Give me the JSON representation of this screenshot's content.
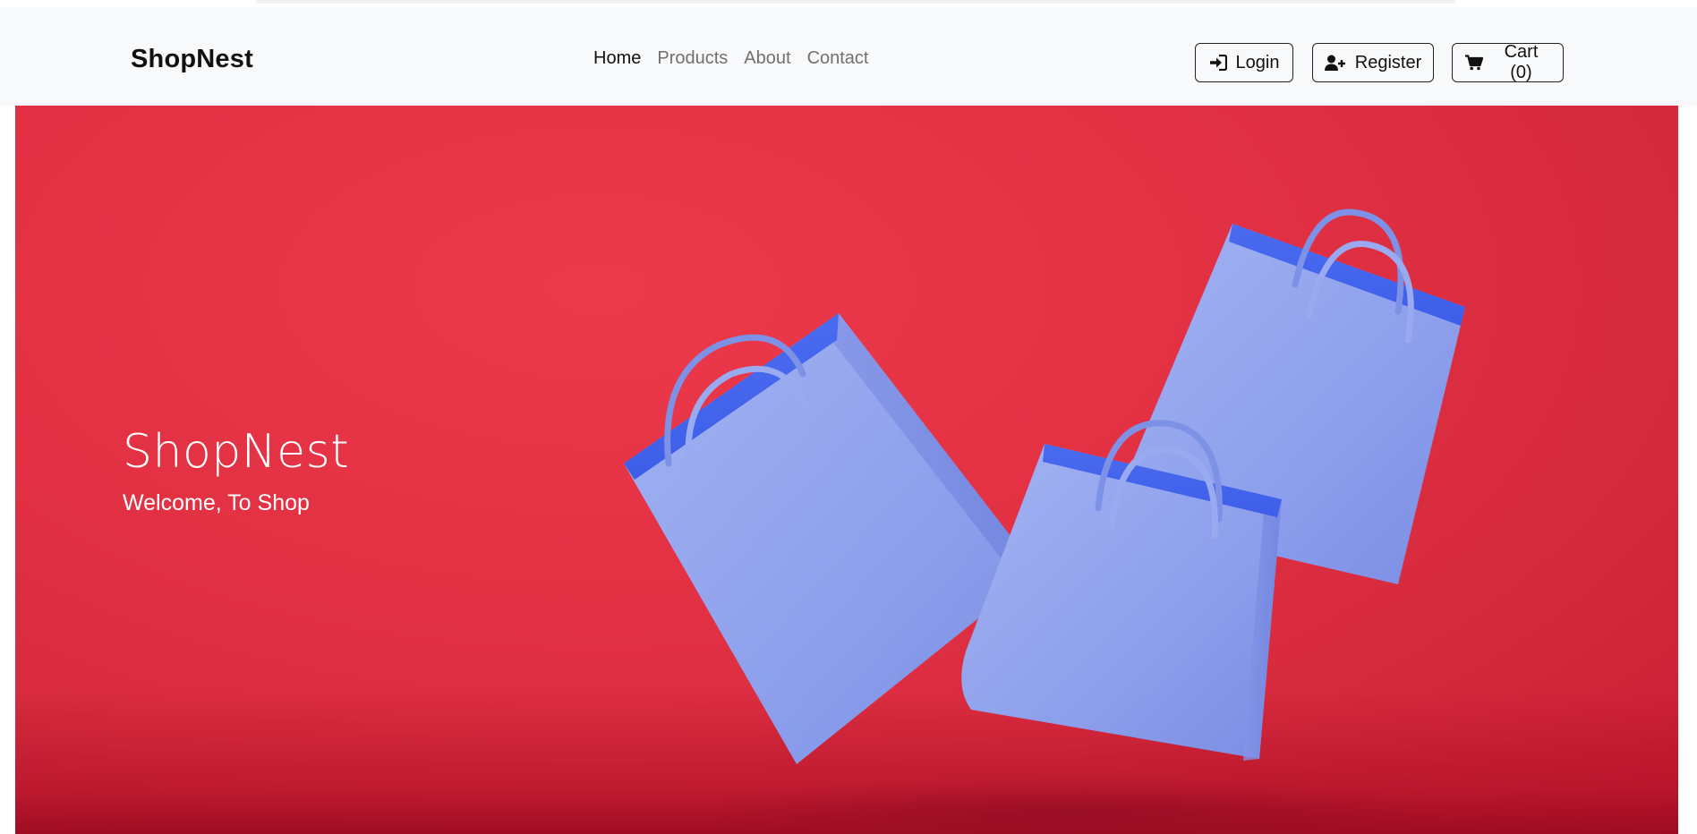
{
  "navbar": {
    "brand": "ShopNest",
    "links": [
      "Home",
      "Products",
      "About",
      "Contact"
    ],
    "active_link": "Home",
    "buttons": {
      "login": "Login",
      "register": "Register",
      "cart": "Cart (0)"
    }
  },
  "hero": {
    "title": "ShopNest",
    "subtitle": "Welcome, To Shop",
    "background_color": "#e33144",
    "bag_color": "#8fa2ee"
  },
  "icons": {
    "login": "sign-in-icon",
    "register": "user-plus-icon",
    "cart": "shopping-cart-icon"
  }
}
